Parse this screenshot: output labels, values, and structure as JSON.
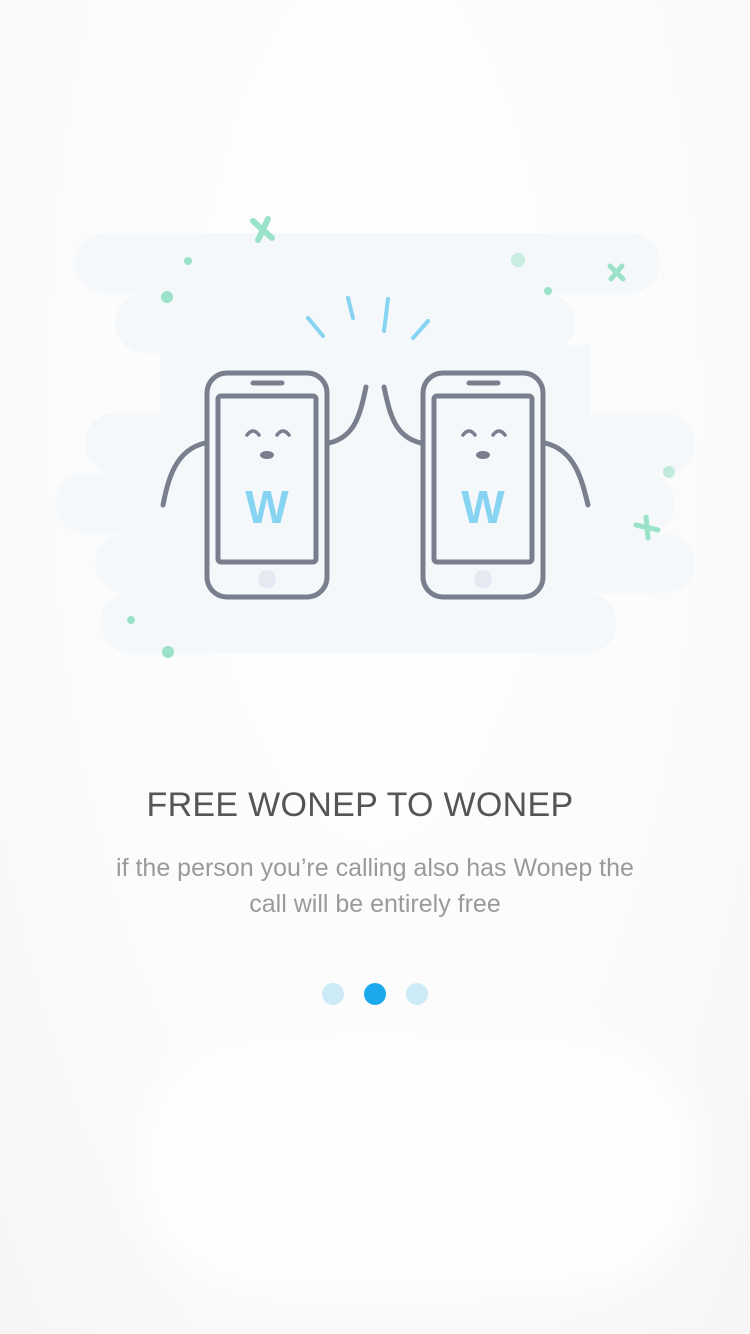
{
  "onboarding": {
    "title": "FREE WONEP TO WONEP",
    "subtitle": "if the person you’re calling also has Wonep the call will be entirely free",
    "illustration": {
      "left_phone_letter": "W",
      "right_phone_letter": "W"
    },
    "pager": {
      "count": 3,
      "active_index": 1
    }
  },
  "colors": {
    "accent": "#1aa9ec",
    "dot_inactive": "#cdeaf7",
    "title": "#555555",
    "subtitle": "#9a9a9a",
    "phone_outline": "#7a7f8e",
    "logo": "#86d3f2",
    "sparkle": "#9be3c8"
  }
}
